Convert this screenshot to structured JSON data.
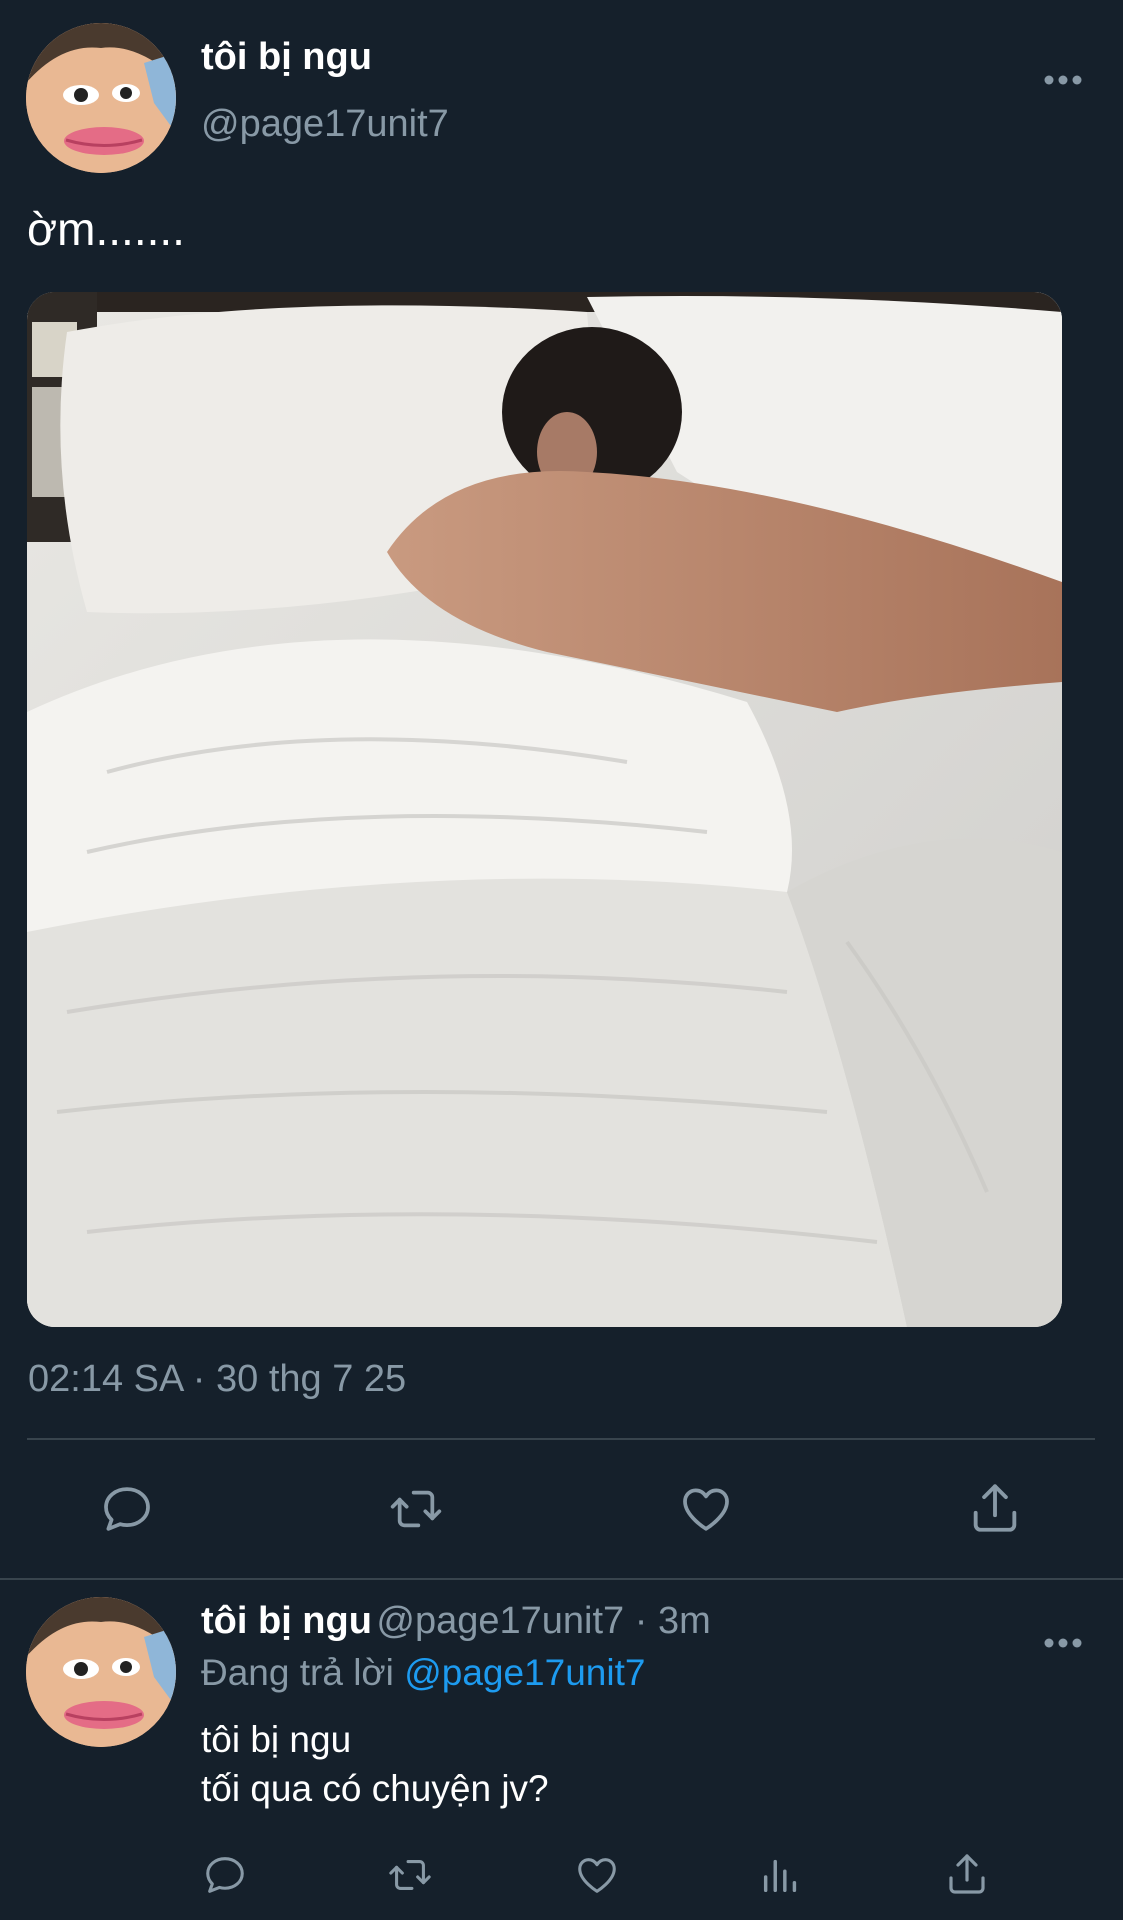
{
  "tweet": {
    "display_name": "tôi bị ngu",
    "handle": "@page17unit7",
    "text": "ờm.......",
    "timestamp": "02:14 SA · 30 thg 7 25",
    "more_icon": "more-horizontal-icon",
    "actions": [
      "reply-icon",
      "retweet-icon",
      "like-icon",
      "share-icon"
    ]
  },
  "reply": {
    "display_name": "tôi bị ngu",
    "handle": "@page17unit7",
    "age": " · 3m",
    "replying_prefix": "Đang trả lời ",
    "replying_to": "@page17unit7",
    "line1": "tôi bị ngu",
    "line2": "tối qua có chuyện jv?",
    "actions": [
      "reply-icon",
      "retweet-icon",
      "like-icon",
      "analytics-icon",
      "share-icon"
    ]
  },
  "colors": {
    "background": "#15202b",
    "secondary_text": "#8899a6",
    "link": "#1d9bf0",
    "divider": "#38444d"
  }
}
